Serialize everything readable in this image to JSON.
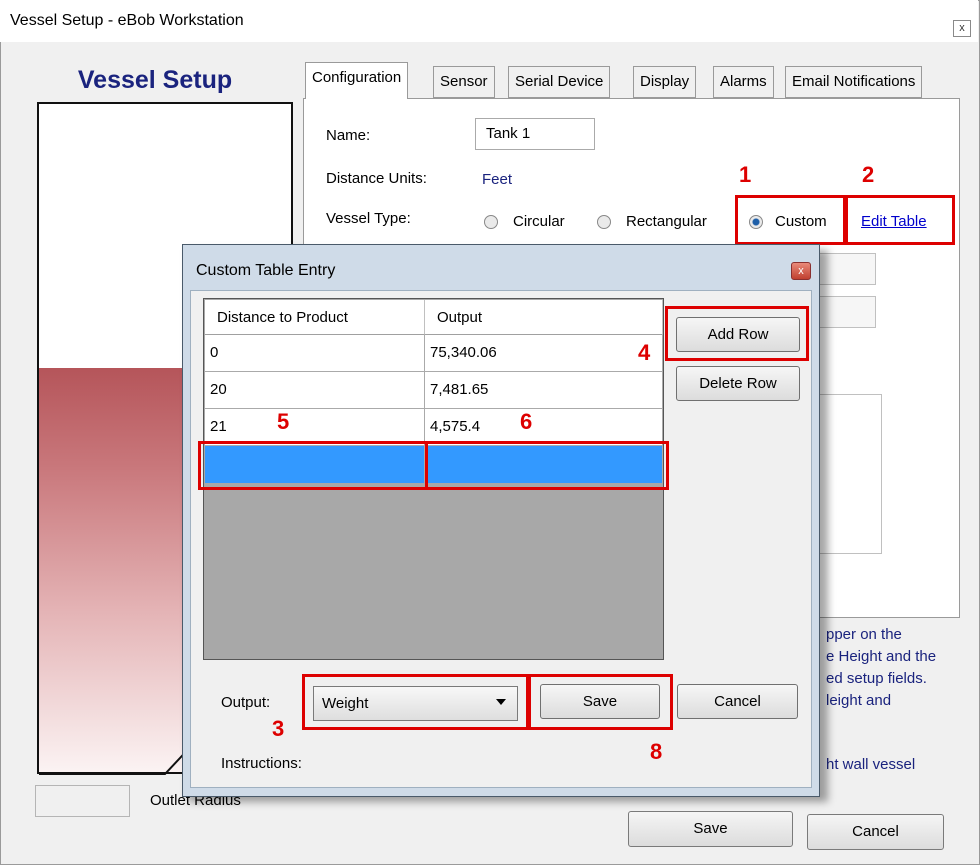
{
  "window": {
    "title": "Vessel Setup - eBob Workstation",
    "close_glyph": "x"
  },
  "panel": {
    "heading": "Vessel Setup",
    "outlet_label": "Outlet Radius"
  },
  "tabs": [
    "Configuration",
    "Sensor",
    "Serial Device",
    "Display",
    "Alarms",
    "Email Notifications"
  ],
  "config": {
    "name_label": "Name:",
    "name_value": "Tank 1",
    "units_label": "Distance Units:",
    "units_value": "Feet",
    "type_label": "Vessel Type:",
    "type_options": [
      "Circular",
      "Rectangular",
      "Custom"
    ],
    "type_selected": "Custom",
    "edit_table_link": "Edit Table",
    "help_lines": [
      "pper on the",
      "e Height and the",
      "ed setup fields.",
      "leight and"
    ],
    "help_line_bottom": "ht wall vessel"
  },
  "footer": {
    "save": "Save",
    "cancel": "Cancel"
  },
  "dialog": {
    "title": "Custom Table Entry",
    "close_glyph": "x",
    "columns": [
      "Distance to Product",
      "Output"
    ],
    "rows": [
      {
        "distance": "0",
        "output": "75,340.06"
      },
      {
        "distance": "20",
        "output": "7,481.65"
      },
      {
        "distance": "21",
        "output": "4,575.4"
      }
    ],
    "add_row": "Add Row",
    "delete_row": "Delete Row",
    "output_label": "Output:",
    "output_value": "Weight",
    "save": "Save",
    "cancel": "Cancel",
    "instructions_label": "Instructions:"
  },
  "callouts": [
    "1",
    "2",
    "3",
    "4",
    "5",
    "6",
    "8"
  ],
  "colors": {
    "highlight_red": "#dd0000",
    "selected_row_blue": "#3399ff",
    "link_blue": "#0000cc",
    "heading_navy": "#1a237e"
  }
}
